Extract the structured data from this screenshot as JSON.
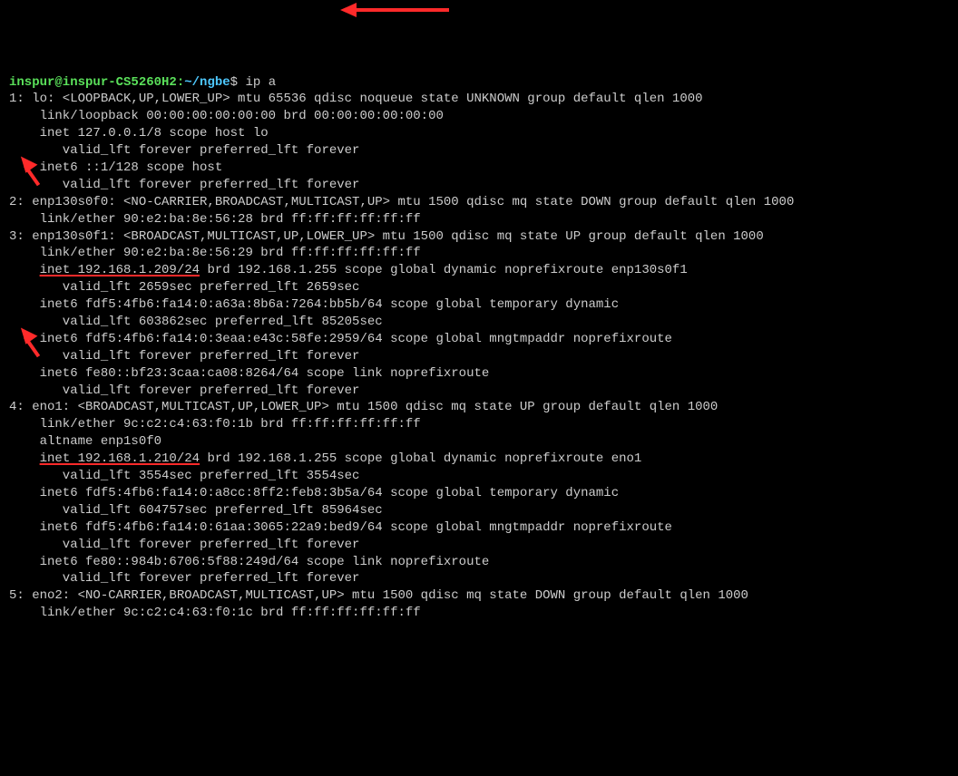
{
  "prompt": {
    "user_host": "inspur@inspur-CS5260H2",
    "sep": ":",
    "path": "~/ngbe",
    "dollar": "$ ",
    "command": "ip a"
  },
  "if1": {
    "line1": "1: lo: <LOOPBACK,UP,LOWER_UP> mtu 65536 qdisc noqueue state UNKNOWN group default qlen 1000",
    "line2": "    link/loopback 00:00:00:00:00:00 brd 00:00:00:00:00:00",
    "line3": "    inet 127.0.0.1/8 scope host lo",
    "line4": "       valid_lft forever preferred_lft forever",
    "line5": "    inet6 ::1/128 scope host",
    "line6": "       valid_lft forever preferred_lft forever"
  },
  "if2": {
    "line1": "2: enp130s0f0: <NO-CARRIER,BROADCAST,MULTICAST,UP> mtu 1500 qdisc mq state DOWN group default qlen 1000",
    "line2": "    link/ether 90:e2:ba:8e:56:28 brd ff:ff:ff:ff:ff:ff"
  },
  "if3": {
    "line1": "3: enp130s0f1: <BROADCAST,MULTICAST,UP,LOWER_UP> mtu 1500 qdisc mq state UP group default qlen 1000",
    "line2": "    link/ether 90:e2:ba:8e:56:29 brd ff:ff:ff:ff:ff:ff",
    "line3_pre": "    ",
    "line3_hl": "inet 192.168.1.209/24",
    "line3_post": " brd 192.168.1.255 scope global dynamic noprefixroute enp130s0f1",
    "line4": "       valid_lft 2659sec preferred_lft 2659sec",
    "line5": "    inet6 fdf5:4fb6:fa14:0:a63a:8b6a:7264:bb5b/64 scope global temporary dynamic",
    "line6": "       valid_lft 603862sec preferred_lft 85205sec",
    "line7": "    inet6 fdf5:4fb6:fa14:0:3eaa:e43c:58fe:2959/64 scope global mngtmpaddr noprefixroute",
    "line8": "       valid_lft forever preferred_lft forever",
    "line9": "    inet6 fe80::bf23:3caa:ca08:8264/64 scope link noprefixroute",
    "line10": "       valid_lft forever preferred_lft forever"
  },
  "if4": {
    "line1": "4: eno1: <BROADCAST,MULTICAST,UP,LOWER_UP> mtu 1500 qdisc mq state UP group default qlen 1000",
    "line2": "    link/ether 9c:c2:c4:63:f0:1b brd ff:ff:ff:ff:ff:ff",
    "line3": "    altname enp1s0f0",
    "line4_pre": "    ",
    "line4_hl": "inet 192.168.1.210/24",
    "line4_post": " brd 192.168.1.255 scope global dynamic noprefixroute eno1",
    "line5": "       valid_lft 3554sec preferred_lft 3554sec",
    "line6": "    inet6 fdf5:4fb6:fa14:0:a8cc:8ff2:feb8:3b5a/64 scope global temporary dynamic",
    "line7": "       valid_lft 604757sec preferred_lft 85964sec",
    "line8": "    inet6 fdf5:4fb6:fa14:0:61aa:3065:22a9:bed9/64 scope global mngtmpaddr noprefixroute",
    "line9": "       valid_lft forever preferred_lft forever",
    "line10": "    inet6 fe80::984b:6706:5f88:249d/64 scope link noprefixroute",
    "line11": "       valid_lft forever preferred_lft forever"
  },
  "if5": {
    "line1": "5: eno2: <NO-CARRIER,BROADCAST,MULTICAST,UP> mtu 1500 qdisc mq state DOWN group default qlen 1000",
    "line2": "    link/ether 9c:c2:c4:63:f0:1c brd ff:ff:ff:ff:ff:ff"
  }
}
